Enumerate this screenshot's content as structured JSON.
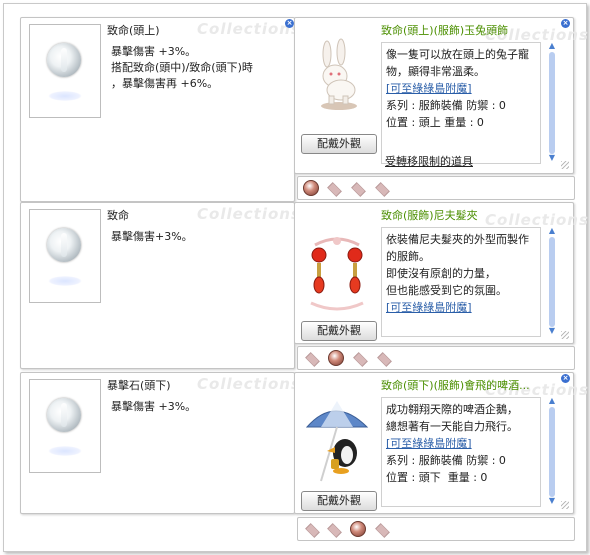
{
  "watermark": "Collections",
  "rows": [
    {
      "card": {
        "title": "致命(頭上)",
        "desc": [
          "暴擊傷害 +3%。",
          "搭配致命(頭中)/致命(頭下)時",
          "，暴擊傷害再 +6%。"
        ]
      },
      "detail": {
        "title": "致命(頭上)(服飾)玉兔頭飾",
        "desc": [
          "像一隻可以放在頭上的兔子寵",
          "物，顯得非常溫柔。"
        ],
        "link": "[可至綠綠島附魔]",
        "stats": [
          "系列 : 服飾裝備 防禦 : 0",
          "位置 : 頭上 重量 : 0"
        ],
        "note": "受轉移限制的道具",
        "button": "配戴外觀"
      }
    },
    {
      "card": {
        "title": "致命",
        "desc": [
          "暴擊傷害+3%。"
        ]
      },
      "detail": {
        "title": "致命(服飾)尼夫髮夾",
        "desc": [
          "依裝備尼夫髮夾的外型而製作",
          "的服飾。",
          "即使沒有原創的力量，",
          "但也能感受到它的氛圍。"
        ],
        "link": "[可至綠綠島附魔]",
        "stats": [],
        "note": "",
        "button": "配戴外觀"
      }
    },
    {
      "card": {
        "title": "暴擊石(頭下)",
        "desc": [
          "暴擊傷害 +3%。"
        ]
      },
      "detail": {
        "title": "致命(頭下)(服飾)會飛的啤酒...",
        "desc": [
          "成功翱翔天際的啤酒企鵝，",
          "總想著有一天能自力飛行。"
        ],
        "link": "[可至綠綠島附魔]",
        "stats": [
          "系列 : 服飾裝備 防禦 : 0",
          "位置 : 頭下  重量 : 0"
        ],
        "note": "",
        "button": "配戴外觀"
      }
    }
  ],
  "close_glyph": "×",
  "scroll_up": "▲",
  "scroll_down": "▼",
  "colors": {
    "title_green": "#4b8f00",
    "link_blue": "#2a5ea8",
    "close_blue": "#3a6fd0"
  }
}
